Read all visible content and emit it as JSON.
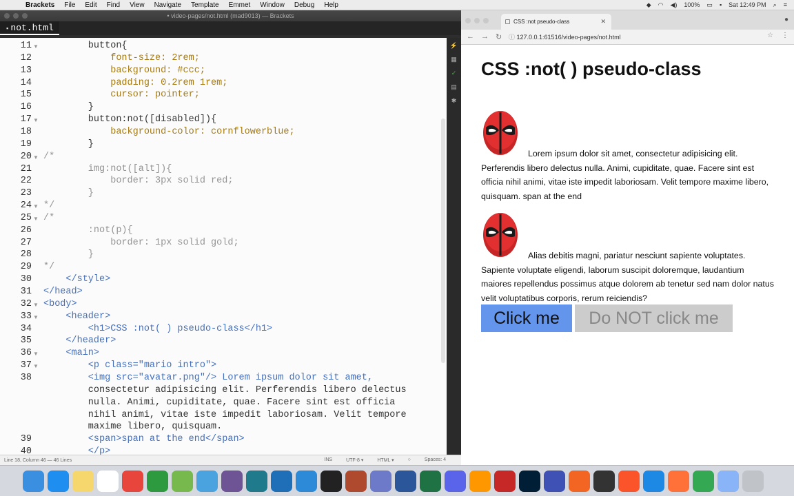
{
  "menubar": {
    "app": "Brackets",
    "items": [
      "File",
      "Edit",
      "Find",
      "View",
      "Navigate",
      "Template",
      "Emmet",
      "Window",
      "Debug",
      "Help"
    ],
    "battery": "100%",
    "clock": "Sat 12:49 PM"
  },
  "brackets": {
    "window_title": "• video-pages/not.html (mad9013) — Brackets",
    "file_tab": "not.html",
    "status": {
      "position": "Line 18, Column 46",
      "lines": "— 46 Lines",
      "mode": "INS",
      "encoding": "UTF-8 ▾",
      "language": "HTML ▾",
      "spaces": "Spaces: 4"
    },
    "code_lines": [
      {
        "n": "11",
        "fold": "▼",
        "text": "        button{"
      },
      {
        "n": "12",
        "fold": "",
        "text": "            font-size: 2rem;"
      },
      {
        "n": "13",
        "fold": "",
        "text": "            background: #ccc;"
      },
      {
        "n": "14",
        "fold": "",
        "text": "            padding: 0.2rem 1rem;"
      },
      {
        "n": "15",
        "fold": "",
        "text": "            cursor: pointer;"
      },
      {
        "n": "16",
        "fold": "",
        "text": "        }"
      },
      {
        "n": "17",
        "fold": "▼",
        "text": "        button:not([disabled]){"
      },
      {
        "n": "18",
        "fold": "",
        "text": "            background-color: cornflowerblue;"
      },
      {
        "n": "19",
        "fold": "",
        "text": "        }"
      },
      {
        "n": "20",
        "fold": "▼",
        "text": "/*"
      },
      {
        "n": "21",
        "fold": "",
        "text": "        img:not([alt]){"
      },
      {
        "n": "22",
        "fold": "",
        "text": "            border: 3px solid red;"
      },
      {
        "n": "23",
        "fold": "",
        "text": "        }"
      },
      {
        "n": "24",
        "fold": "▼",
        "text": "*/"
      },
      {
        "n": "25",
        "fold": "▼",
        "text": "/*"
      },
      {
        "n": "26",
        "fold": "",
        "text": "        :not(p){"
      },
      {
        "n": "27",
        "fold": "",
        "text": "            border: 1px solid gold;"
      },
      {
        "n": "28",
        "fold": "",
        "text": "        }"
      },
      {
        "n": "29",
        "fold": "",
        "text": "*/"
      },
      {
        "n": "30",
        "fold": "",
        "text": "    </style>"
      },
      {
        "n": "31",
        "fold": "",
        "text": "</head>"
      },
      {
        "n": "32",
        "fold": "▼",
        "text": "<body>"
      },
      {
        "n": "33",
        "fold": "▼",
        "text": "    <header>"
      },
      {
        "n": "34",
        "fold": "",
        "text": "        <h1>CSS :not( ) pseudo-class</h1>"
      },
      {
        "n": "35",
        "fold": "",
        "text": "    </header>"
      },
      {
        "n": "36",
        "fold": "▼",
        "text": "    <main>"
      },
      {
        "n": "37",
        "fold": "▼",
        "text": "        <p class=\"mario intro\">"
      },
      {
        "n": "38",
        "fold": "",
        "text": "        <img src=\"avatar.png\"/> Lorem ipsum dolor sit amet,"
      },
      {
        "n": "",
        "fold": "",
        "text": "        consectetur adipisicing elit. Perferendis libero delectus"
      },
      {
        "n": "",
        "fold": "",
        "text": "        nulla. Animi, cupiditate, quae. Facere sint est officia"
      },
      {
        "n": "",
        "fold": "",
        "text": "        nihil animi, vitae iste impedit laboriosam. Velit tempore"
      },
      {
        "n": "",
        "fold": "",
        "text": "        maxime libero, quisquam."
      },
      {
        "n": "39",
        "fold": "",
        "text": "        <span>span at the end</span>"
      },
      {
        "n": "40",
        "fold": "",
        "text": "        </p>"
      }
    ]
  },
  "chrome": {
    "tab_title": "CSS :not pseudo-class",
    "url": "127.0.0.1:61516/video-pages/not.html",
    "page": {
      "h1": "CSS :not( ) pseudo-class",
      "para1": "Lorem ipsum dolor sit amet, consectetur adipisicing elit. Perferendis libero delectus nulla. Animi, cupiditate, quae. Facere sint est officia nihil animi, vitae iste impedit laboriosam. Velit tempore maxime libero, quisquam. span at the end",
      "para2": "Alias debitis magni, pariatur nesciunt sapiente voluptates. Sapiente voluptate eligendi, laborum suscipit doloremque, laudantium maiores repellendus possimus atque dolorem ab tenetur sed nam dolor natus velit voluptatibus corporis, rerum reiciendis?",
      "button1": "Click me",
      "button2": "Do NOT click me"
    }
  },
  "dock": {
    "icons": [
      {
        "name": "finder-icon",
        "color": "#3b8fe0"
      },
      {
        "name": "app-store-icon",
        "color": "#1f8ef1"
      },
      {
        "name": "notes-icon",
        "color": "#f5d76e"
      },
      {
        "name": "calendar-icon",
        "color": "#ffffff"
      },
      {
        "name": "chrome-icon",
        "color": "#e8453c"
      },
      {
        "name": "leaf-icon",
        "color": "#2e9a3f"
      },
      {
        "name": "android-icon",
        "color": "#78b94d"
      },
      {
        "name": "folder-icon",
        "color": "#4aa3df"
      },
      {
        "name": "github-icon",
        "color": "#6e5494"
      },
      {
        "name": "gitkraken-icon",
        "color": "#1f7a8c"
      },
      {
        "name": "vscode-icon",
        "color": "#1e6fb8"
      },
      {
        "name": "brackets-icon",
        "color": "#2d8ad8"
      },
      {
        "name": "terminal-icon",
        "color": "#222222"
      },
      {
        "name": "cube-icon",
        "color": "#b04a2e"
      },
      {
        "name": "elephant-icon",
        "color": "#6c7ac9"
      },
      {
        "name": "word-icon",
        "color": "#2b579a"
      },
      {
        "name": "excel-icon",
        "color": "#1f7244"
      },
      {
        "name": "discord-icon",
        "color": "#5a64ea"
      },
      {
        "name": "sublime-icon",
        "color": "#ff9800"
      },
      {
        "name": "filezilla-icon",
        "color": "#c62828"
      },
      {
        "name": "photoshop-icon",
        "color": "#001e36"
      },
      {
        "name": "firefox-dev-icon",
        "color": "#3f51b5"
      },
      {
        "name": "pen-icon",
        "color": "#f26522"
      },
      {
        "name": "github-desktop-icon",
        "color": "#333333"
      },
      {
        "name": "brave-icon",
        "color": "#fb542b"
      },
      {
        "name": "safari-icon",
        "color": "#1e88e5"
      },
      {
        "name": "firefox-icon",
        "color": "#ff7139"
      },
      {
        "name": "chrome2-icon",
        "color": "#34a853"
      },
      {
        "name": "downloads-icon",
        "color": "#8ab4f8"
      },
      {
        "name": "trash-icon",
        "color": "#c0c4c9"
      }
    ]
  }
}
